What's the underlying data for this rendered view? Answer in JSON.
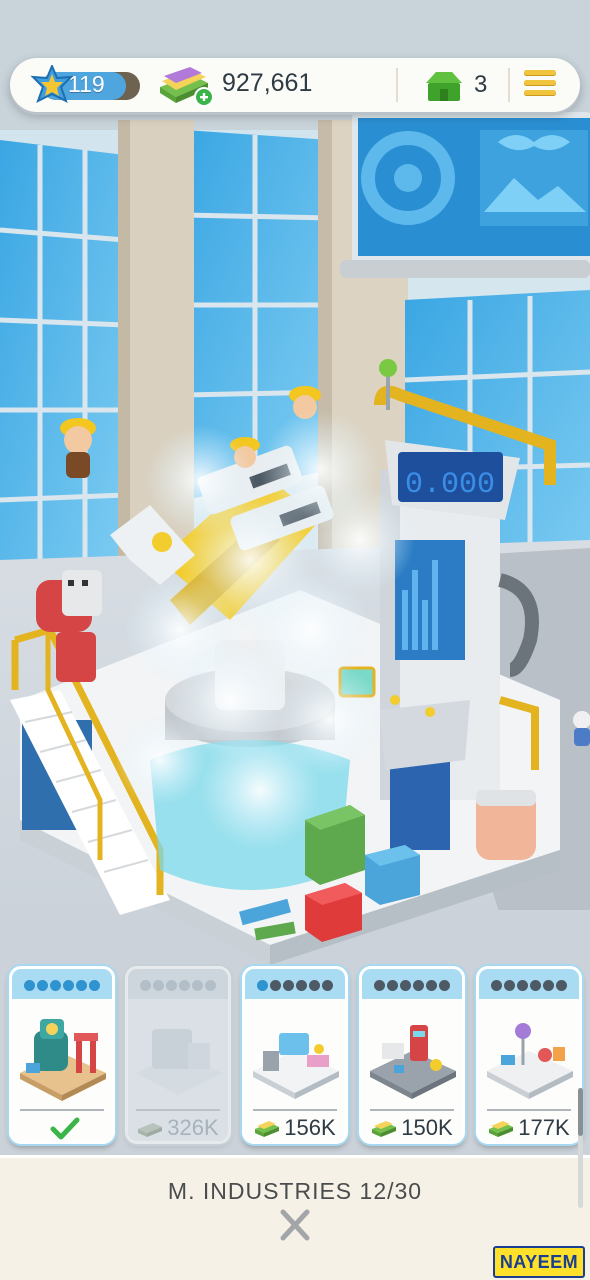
{
  "hud": {
    "level": "119",
    "level_progress": 0.86,
    "cash": "927,661",
    "houses": "3",
    "icons": [
      "star-icon",
      "cash-stack-icon",
      "plus-icon",
      "house-icon",
      "menu-icon"
    ]
  },
  "cards": [
    {
      "stars_filled": 6,
      "stars_total": 6,
      "status": "owned",
      "icon": "checkmark-icon",
      "price": ""
    },
    {
      "stars_filled": 0,
      "stars_total": 6,
      "status": "locked",
      "price": "326K"
    },
    {
      "stars_filled": 1,
      "stars_total": 6,
      "status": "available",
      "price": "156K"
    },
    {
      "stars_filled": 0,
      "stars_total": 6,
      "status": "available",
      "price": "150K"
    },
    {
      "stars_filled": 0,
      "stars_total": 6,
      "status": "available",
      "price": "177K"
    }
  ],
  "panel": {
    "title": "M. INDUSTRIES 12/30",
    "close_icon": "close-x-icon"
  },
  "watermark": "NAYEEM",
  "colors": {
    "sky_glass": "#4fb3e6",
    "accent_yellow": "#f0c43c",
    "level_blue": "#4fa6df",
    "panel_bg": "#f6f1e6",
    "card_header": "#a9dcf2"
  }
}
